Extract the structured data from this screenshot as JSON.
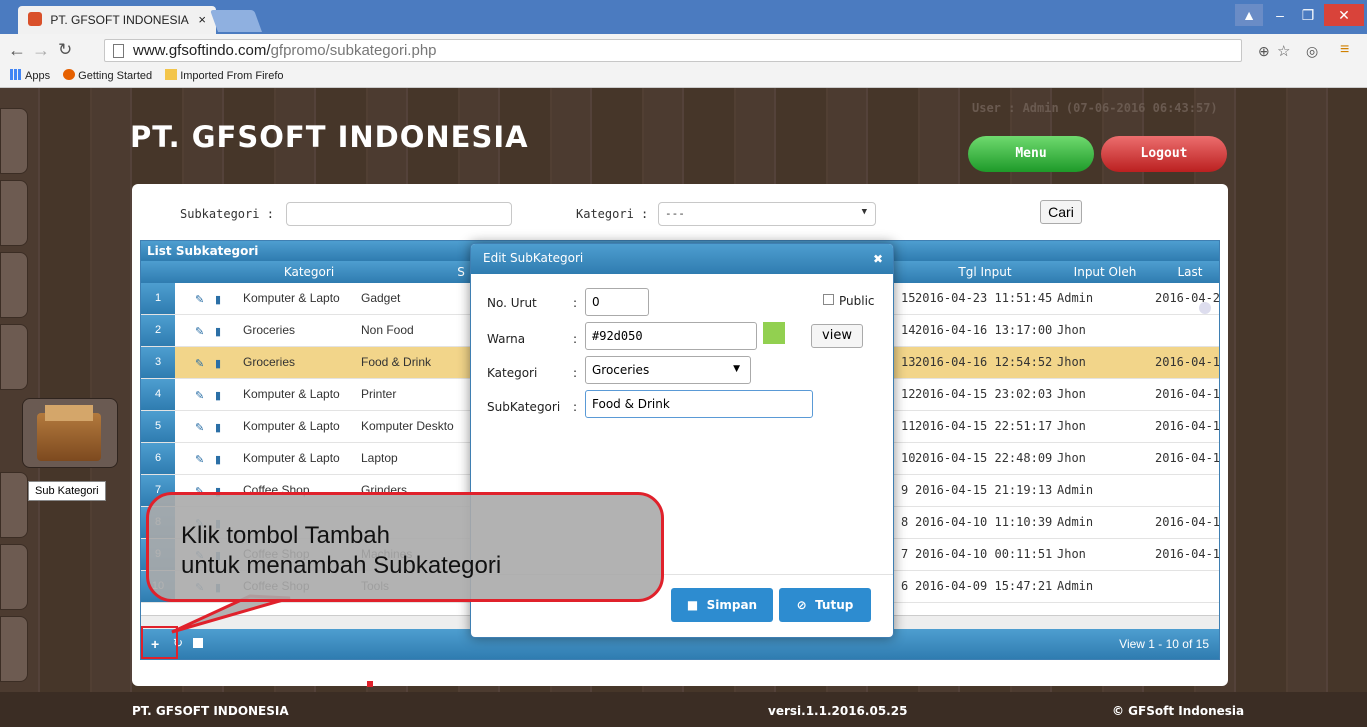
{
  "browser": {
    "tab_title": "PT. GFSOFT INDONESIA",
    "tab_close": "×",
    "url_host": "www.gfsoftindo.com/",
    "url_path": "gfpromo/subkategori.php",
    "bookmarks": [
      "Apps",
      "Getting Started",
      "Imported From Firefo"
    ]
  },
  "header": {
    "company": "PT. GFSOFT INDONESIA",
    "user_info": "User : Admin (07-06-2016 06:43:57)",
    "menu_label": "Menu",
    "logout_label": "Logout"
  },
  "sidebar": {
    "subkategori_label": "Sub Kategori"
  },
  "filter": {
    "subkategori_label": "Subkategori :",
    "kategori_label": "Kategori :",
    "kategori_value": "---",
    "cari_label": "Cari"
  },
  "grid": {
    "title": "List Subkategori",
    "headers": [
      "Kategori",
      "S",
      "Tgl Input",
      "Input Oleh",
      "Last"
    ],
    "rows": [
      {
        "no": "1",
        "kategori": "Komputer & Lapto",
        "sub": "Gadget",
        "ord": "15",
        "tgl": "2016-04-23 11:51:45",
        "oleh": "Admin",
        "last": "2016-04-2"
      },
      {
        "no": "2",
        "kategori": "Groceries",
        "sub": "Non Food",
        "ord": "14",
        "tgl": "2016-04-16 13:17:00",
        "oleh": "Jhon",
        "last": ""
      },
      {
        "no": "3",
        "kategori": "Groceries",
        "sub": "Food & Drink",
        "ord": "13",
        "tgl": "2016-04-16 12:54:52",
        "oleh": "Jhon",
        "last": "2016-04-1"
      },
      {
        "no": "4",
        "kategori": "Komputer & Lapto",
        "sub": "Printer",
        "ord": "12",
        "tgl": "2016-04-15 23:02:03",
        "oleh": "Jhon",
        "last": "2016-04-1"
      },
      {
        "no": "5",
        "kategori": "Komputer & Lapto",
        "sub": "Komputer Deskto",
        "ord": "11",
        "tgl": "2016-04-15 22:51:17",
        "oleh": "Jhon",
        "last": "2016-04-1"
      },
      {
        "no": "6",
        "kategori": "Komputer & Lapto",
        "sub": "Laptop",
        "ord": "10",
        "tgl": "2016-04-15 22:48:09",
        "oleh": "Jhon",
        "last": "2016-04-1"
      },
      {
        "no": "7",
        "kategori": "Coffee Shop",
        "sub": "Grinders",
        "ord": "9",
        "tgl": "2016-04-15 21:19:13",
        "oleh": "Admin",
        "last": ""
      },
      {
        "no": "8",
        "kategori": "",
        "sub": "",
        "ord": "8",
        "tgl": "2016-04-10 11:10:39",
        "oleh": "Admin",
        "last": "2016-04-1"
      },
      {
        "no": "9",
        "kategori": "Coffee Shop",
        "sub": "Machines",
        "ord": "7",
        "tgl": "2016-04-10 00:11:51",
        "oleh": "Jhon",
        "last": "2016-04-1"
      },
      {
        "no": "10",
        "kategori": "Coffee Shop",
        "sub": "Tools",
        "ord": "6",
        "tgl": "2016-04-09 15:47:21",
        "oleh": "Admin",
        "last": ""
      }
    ],
    "footer_view": "View 1 - 10 of 15"
  },
  "modal": {
    "title": "Edit SubKategori",
    "no_urut_label": "No. Urut",
    "no_urut_value": "0",
    "public_label": "Public",
    "warna_label": "Warna",
    "warna_value": "#92d050",
    "view_label": "view",
    "kategori_label": "Kategori",
    "kategori_value": "Groceries",
    "subkategori_label": "SubKategori",
    "subkategori_value": "Food & Drink",
    "colon": ":",
    "simpan_label": "Simpan",
    "tutup_label": "Tutup"
  },
  "callout": {
    "line1": "Klik tombol Tambah",
    "line2": "untuk menambah Subkategori"
  },
  "footer": {
    "left": "PT. GFSOFT INDONESIA",
    "center": "versi.1.1.2016.05.25",
    "right": "© GFSoft Indonesia"
  },
  "colors": {
    "swatch": "#92d050",
    "accent": "#2f7cb0",
    "highlight_row": "#f2d58a"
  }
}
